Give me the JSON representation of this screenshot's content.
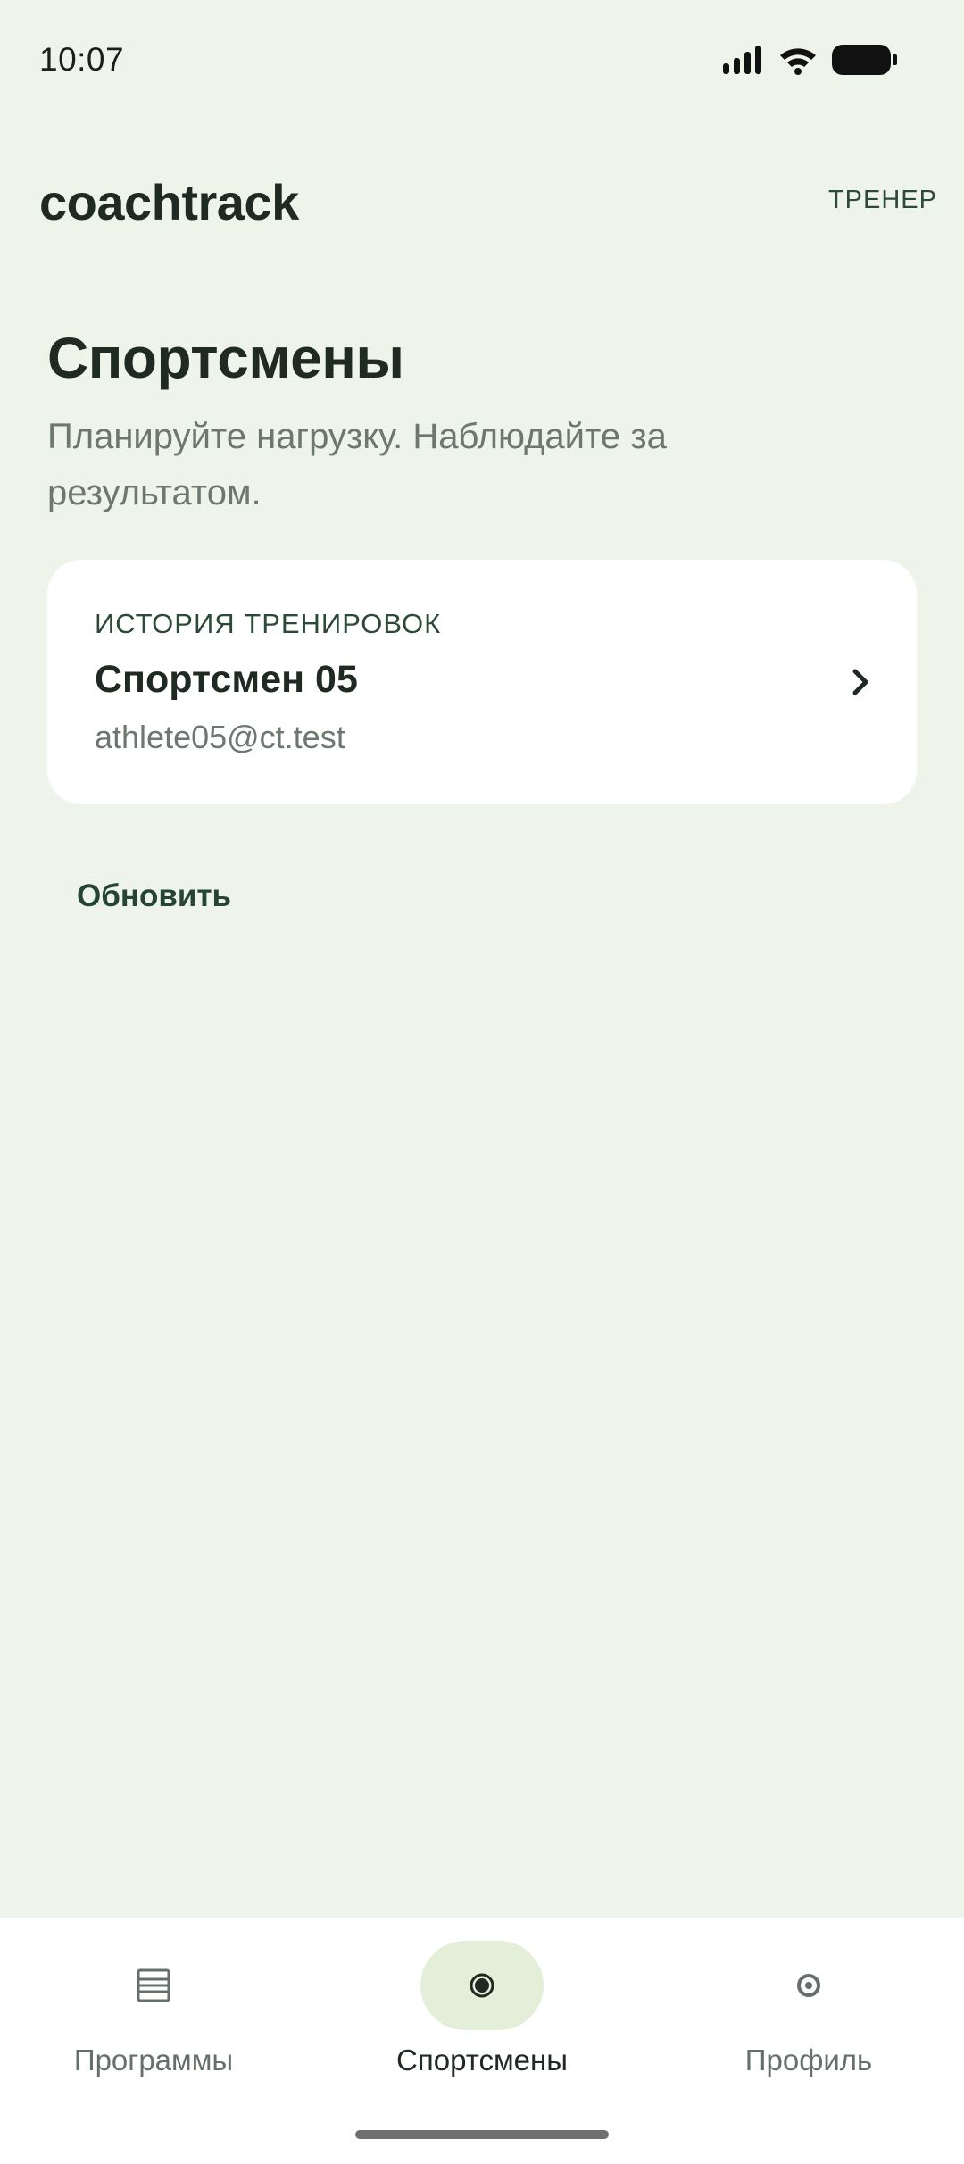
{
  "status_bar": {
    "time": "10:07",
    "icons": [
      "signal-icon",
      "wifi-icon",
      "battery-icon"
    ]
  },
  "header": {
    "brand": "coachtrack",
    "role": "ТРЕНЕР"
  },
  "page": {
    "title": "Спортсмены",
    "subtitle": "Планируйте нагрузку. Наблюдайте за результатом."
  },
  "athlete_card": {
    "eyebrow": "ИСТОРИЯ ТРЕНИРОВОК",
    "name": "Спортсмен 05",
    "email": "athlete05@ct.test",
    "icon": "chevron-right-icon"
  },
  "actions": {
    "refresh_label": "Обновить"
  },
  "bottom_nav": {
    "items": [
      {
        "label": "Программы",
        "icon": "list-icon",
        "active": false
      },
      {
        "label": "Спортсмены",
        "icon": "dot-icon",
        "active": true
      },
      {
        "label": "Профиль",
        "icon": "ring-icon",
        "active": false
      }
    ]
  },
  "colors": {
    "background": "#eff4eb",
    "surface": "#ffffff",
    "accent": "#254431",
    "active_pill": "#e3efd8",
    "muted_text": "#6c7770"
  }
}
